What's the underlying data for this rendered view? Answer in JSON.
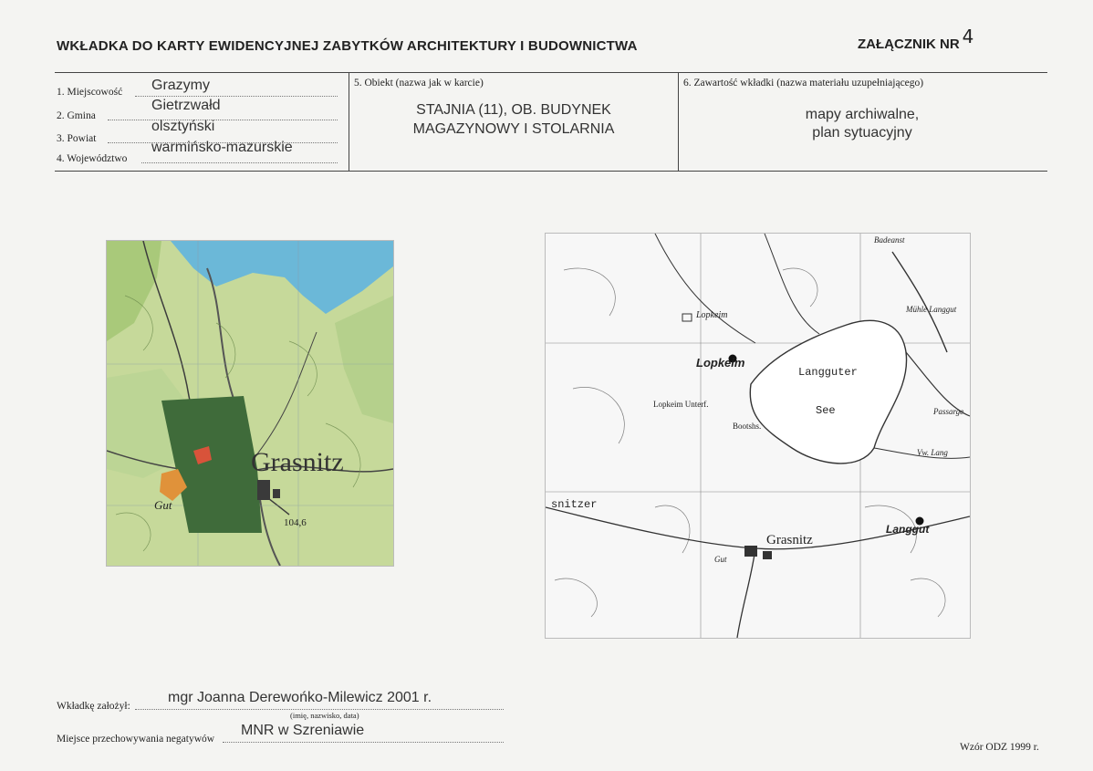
{
  "header": {
    "title": "WKŁADKA DO KARTY EWIDENCYJNEJ ZABYTKÓW ARCHITEKTURY I BUDOWNICTWA",
    "annex_label": "ZAŁĄCZNIK NR",
    "annex_number": "4"
  },
  "location": {
    "miejscowosc_label": "1. Miejscowość",
    "miejscowosc": "Grazymy",
    "gmina_label": "2. Gmina",
    "gmina": "Gietrzwałd",
    "powiat_label": "3. Powiat",
    "powiat": "olsztyński",
    "wojewodztwo_label": "4. Województwo",
    "wojewodztwo": "warmińsko-mazurskie"
  },
  "object": {
    "label": "5. Obiekt (nazwa jak w karcie)",
    "line1": "STAJNIA (11), OB. BUDYNEK",
    "line2": "MAGAZYNOWY I STOLARNIA"
  },
  "contents": {
    "label": "6. Zawartość wkładki (nazwa materiału uzupełniającego)",
    "line1": "mapy archiwalne,",
    "line2": "plan sytuacyjny"
  },
  "map_left": {
    "town": "Grasnitz",
    "gut": "Gut",
    "elev": "104,6"
  },
  "map_right": {
    "lopkeim_small": "Lopkeim",
    "lopkeim": "Lopkeim",
    "lake1": "Langguter",
    "lake2": "See",
    "bootshs": "Bootshs.",
    "grasnitz": "Grasnitz",
    "snitzer": "snitzer",
    "langgut": "Langgut",
    "badeanst": "Badeanst",
    "muhle": "Mühle Langgut",
    "passarge": "Passarge",
    "vw_lang": "Vw. Lang",
    "gut": "Gut",
    "lopkeim_unterf": "Lopkeim Unterf."
  },
  "footer": {
    "founder_label": "Wkładkę założył:",
    "founder": "mgr Joanna Derewońko-Milewicz 2001 r.",
    "founder_hint": "(imię, nazwisko, data)",
    "storage_label": "Miejsce przechowywania negatywów",
    "storage": "MNR w Szreniawie",
    "template": "Wzór ODZ 1999 r."
  },
  "colors": {
    "map_green": "#b7cf8f",
    "map_water": "#6bb8d8",
    "map_dark_green": "#3f6b3a",
    "accent_red": "#d8533a"
  }
}
